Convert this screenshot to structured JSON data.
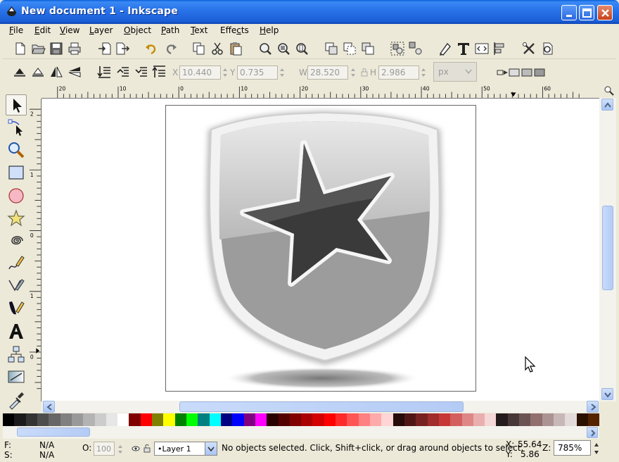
{
  "window": {
    "title": "New document 1 - Inkscape"
  },
  "menu": [
    {
      "label": "File",
      "mnemonic": "F"
    },
    {
      "label": "Edit",
      "mnemonic": "E"
    },
    {
      "label": "View",
      "mnemonic": "V"
    },
    {
      "label": "Layer",
      "mnemonic": "L"
    },
    {
      "label": "Object",
      "mnemonic": "O"
    },
    {
      "label": "Path",
      "mnemonic": "P"
    },
    {
      "label": "Text",
      "mnemonic": "T"
    },
    {
      "label": "Effects",
      "mnemonic": "c"
    },
    {
      "label": "Help",
      "mnemonic": "H"
    }
  ],
  "selector_toolbar": {
    "x_label": "X",
    "x_value": "10.440",
    "y_label": "Y",
    "y_value": "0.735",
    "w_label": "W",
    "w_value": "28.520",
    "h_label": "H",
    "h_value": "2.986",
    "unit": "px"
  },
  "ruler": {
    "horizontal_labels": [
      "20",
      "10",
      "0",
      "10",
      "20",
      "30",
      "40",
      "50",
      "60"
    ],
    "vertical_labels": [
      "2",
      "1",
      "0",
      "1",
      "0"
    ]
  },
  "palette": [
    "#000000",
    "#1a1a1a",
    "#333333",
    "#4d4d4d",
    "#666666",
    "#808080",
    "#999999",
    "#b3b3b3",
    "#cccccc",
    "#e6e6e6",
    "#ffffff",
    "#800000",
    "#ff0000",
    "#808000",
    "#ffff00",
    "#008000",
    "#00ff00",
    "#008080",
    "#00ffff",
    "#000080",
    "#0000ff",
    "#800080",
    "#ff00ff",
    "#2b0000",
    "#550000",
    "#800000",
    "#aa0000",
    "#d40000",
    "#ff0000",
    "#ff2a2a",
    "#ff5555",
    "#ff8080",
    "#ffaaaa",
    "#ffd5d5",
    "#280b0b",
    "#501616",
    "#782121",
    "#a02c2c",
    "#c83737",
    "#d35f5f",
    "#de8787",
    "#e9afaf",
    "#f4d7d7",
    "#241c1c",
    "#483737",
    "#6c5353",
    "#916f6f",
    "#ac9393",
    "#c8b7b7",
    "#e3dbdb",
    "#2b1100",
    "#552200"
  ],
  "status": {
    "fill_label": "F:",
    "fill_value": "N/A",
    "stroke_label": "S:",
    "stroke_value": "N/A",
    "opacity_label": "O:",
    "opacity_value": "100",
    "layer": "•Layer 1",
    "message": "No objects selected. Click, Shift+click, or drag around objects to select.",
    "x_label": "X:",
    "x_value": "55.64",
    "y_label": "Y:",
    "y_value": "5.86",
    "z_label": "Z:",
    "zoom_value": "785%"
  }
}
